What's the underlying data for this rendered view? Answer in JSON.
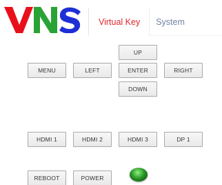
{
  "logo": {
    "text": "VNS",
    "colors": [
      "#e8101b",
      "#2aa336",
      "#1e2fd6"
    ]
  },
  "tabs": [
    {
      "label": "Virtual Key",
      "active": true
    },
    {
      "label": "System",
      "active": false
    }
  ],
  "nav_pad": {
    "up": "UP",
    "menu": "MENU",
    "left": "LEFT",
    "enter": "ENTER",
    "right": "RIGHT",
    "down": "DOWN"
  },
  "inputs": {
    "hdmi1": "HDMI 1",
    "hdmi2": "HDMI 2",
    "hdmi3": "HDMI 3",
    "dp1": "DP 1"
  },
  "system_buttons": {
    "reboot": "REBOOT",
    "power": "POWER"
  },
  "status": {
    "led_color": "#2c9a28",
    "led_icon": "power-status-led"
  }
}
